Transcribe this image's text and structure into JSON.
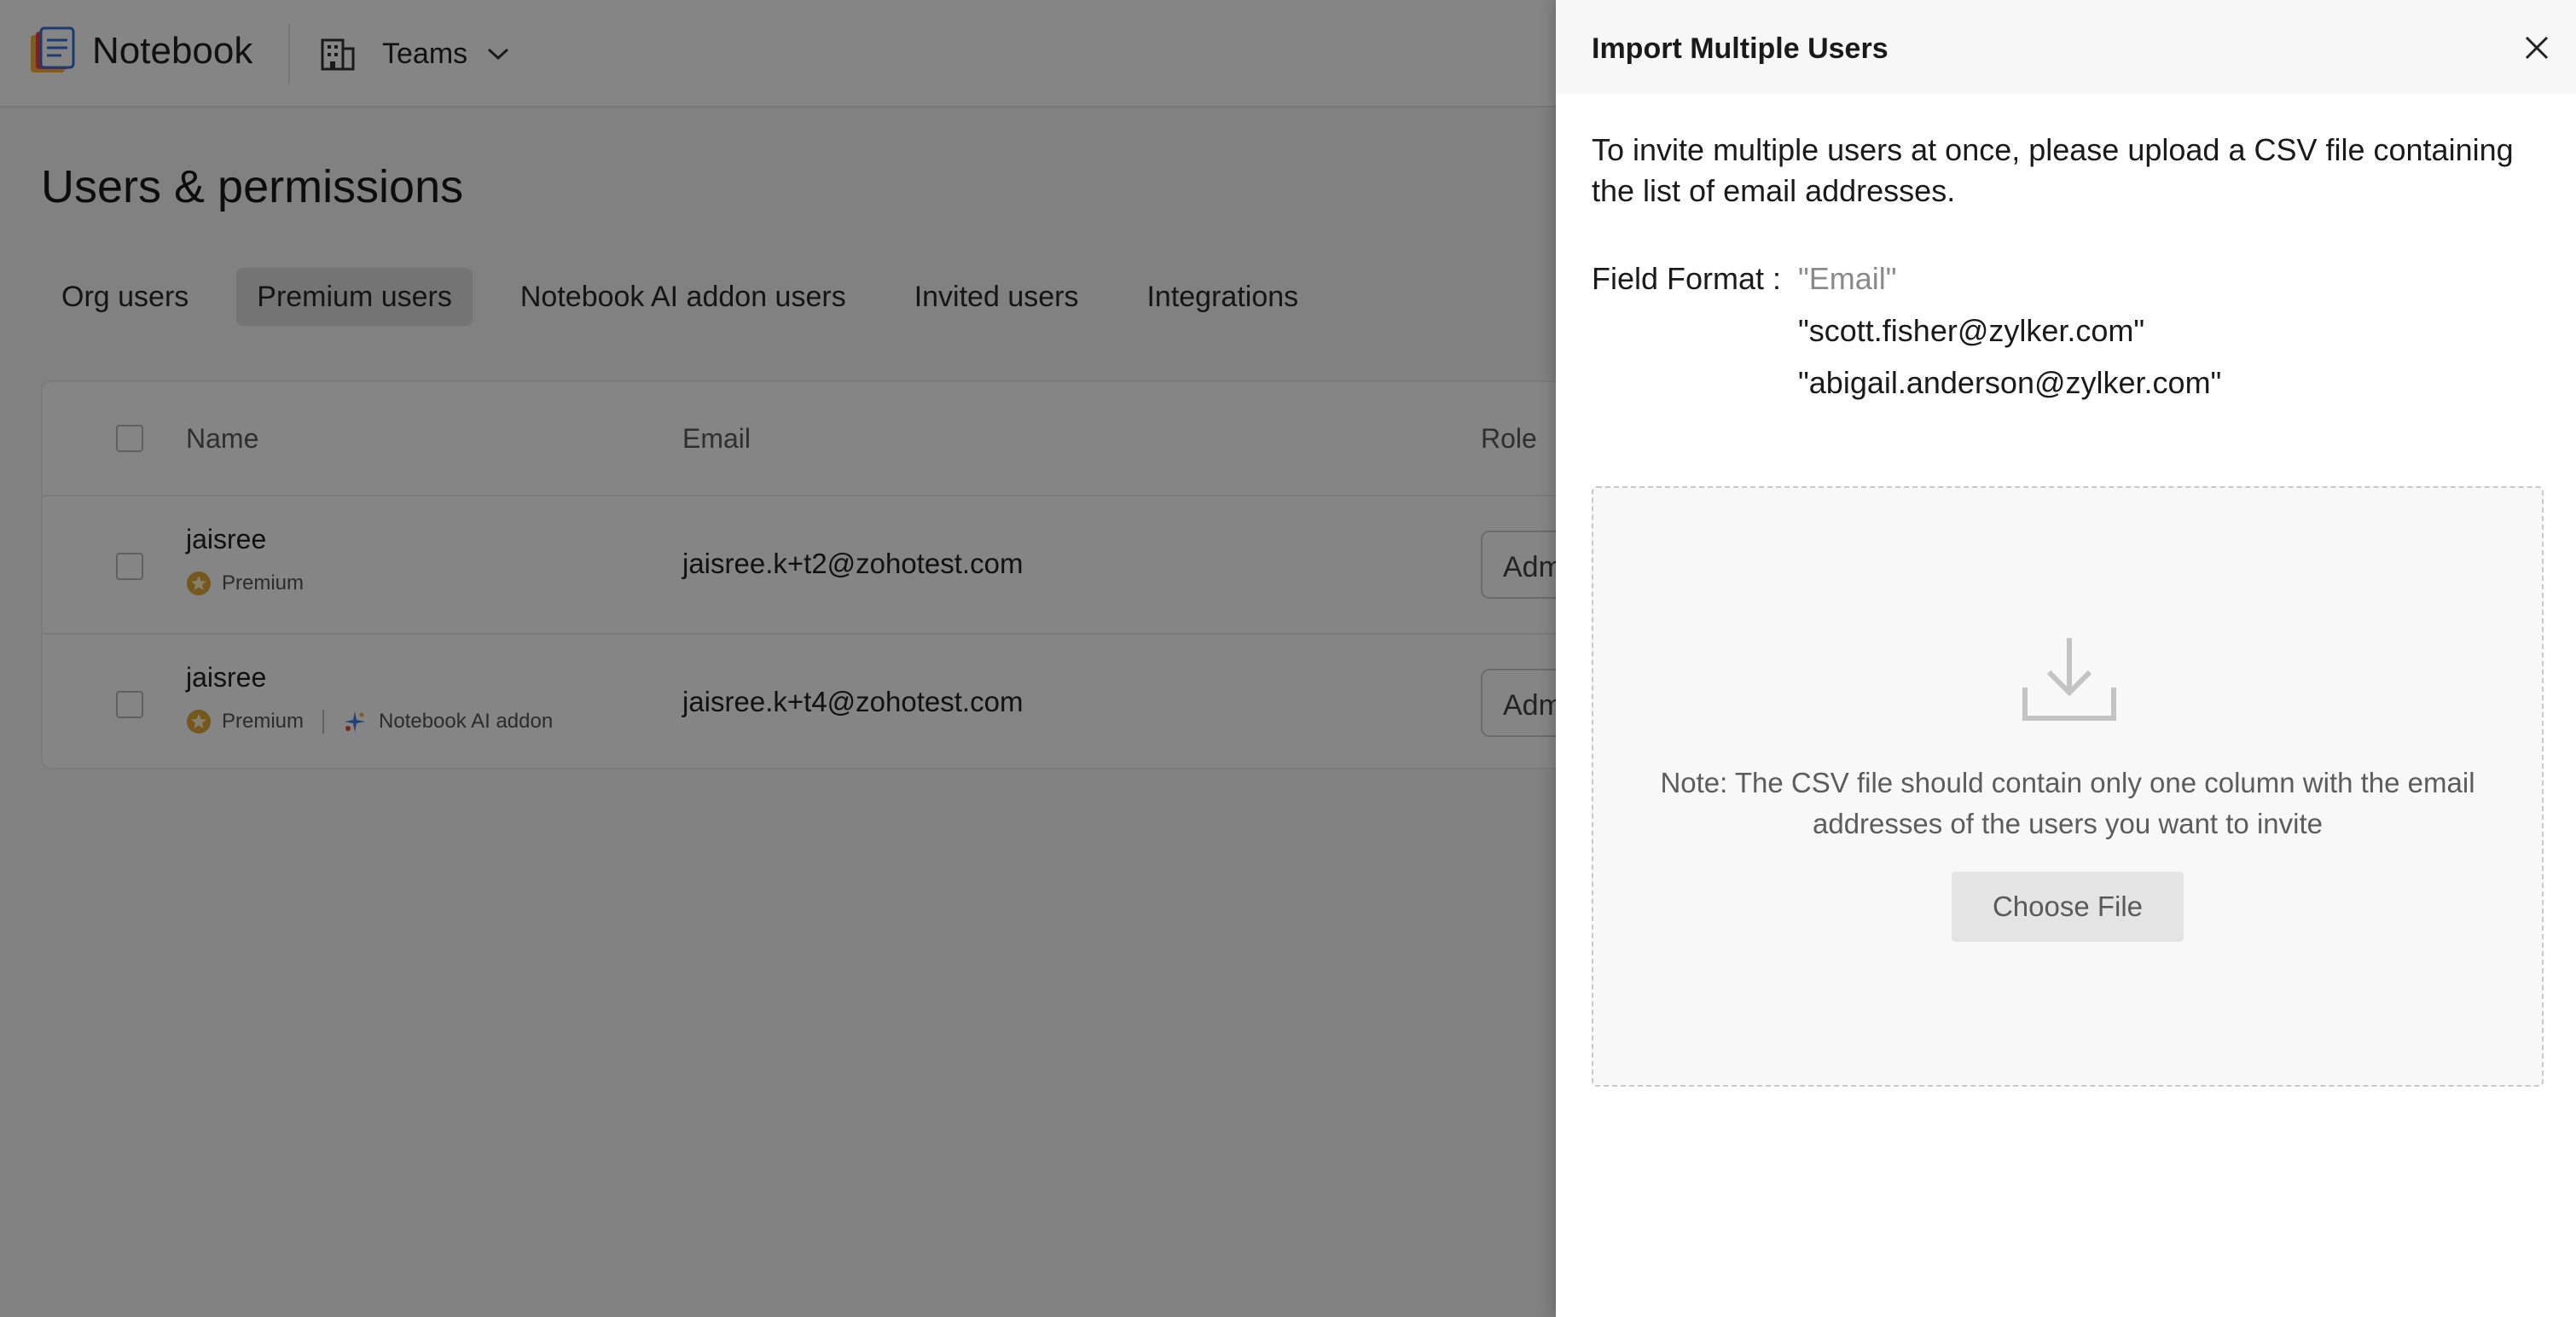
{
  "app": {
    "name": "Notebook",
    "workspace": "Teams"
  },
  "page": {
    "title": "Users & permissions",
    "tabs": [
      {
        "label": "Org users"
      },
      {
        "label": "Premium users"
      },
      {
        "label": "Notebook AI addon users"
      },
      {
        "label": "Invited users"
      },
      {
        "label": "Integrations"
      }
    ],
    "active_tab": "Premium users"
  },
  "table": {
    "columns": {
      "name": "Name",
      "email": "Email",
      "role": "Role"
    },
    "rows": [
      {
        "name": "jaisree",
        "badge": "Premium",
        "addon": "",
        "email": "jaisree.k+t2@zohotest.com",
        "role": "Admin"
      },
      {
        "name": "jaisree",
        "badge": "Premium",
        "addon": "Notebook AI addon",
        "email": "jaisree.k+t4@zohotest.com",
        "role": "Admin"
      }
    ]
  },
  "panel": {
    "title": "Import Multiple Users",
    "intro": "To invite multiple users at once, please upload a CSV file containing the list of email addresses.",
    "field_format_label": "Field Format :",
    "field_format_lines": [
      "\"Email\"",
      "\"scott.fisher@zylker.com\"",
      "\"abigail.anderson@zylker.com\""
    ],
    "note": "Note: The CSV file should contain only one column with the email addresses of the users you want to invite",
    "choose_file_label": "Choose File"
  },
  "colors": {
    "overlay": "#000000",
    "premium_badge": "#e0a93a",
    "panel_header_bg": "#f7f7f7"
  }
}
